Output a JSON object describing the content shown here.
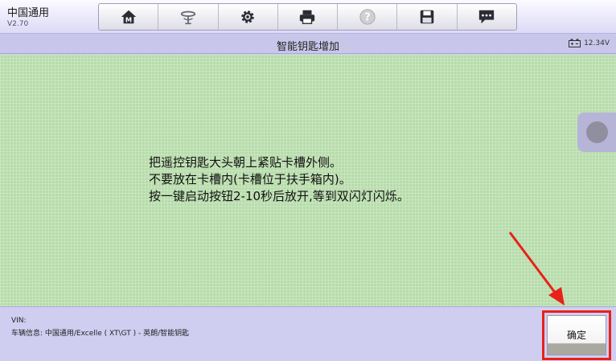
{
  "app": {
    "title": "中国通用",
    "version": "V2.70"
  },
  "toolbar": {
    "items": [
      {
        "name": "home-icon",
        "label": "M"
      },
      {
        "name": "vehicle-change-icon"
      },
      {
        "name": "settings-icon"
      },
      {
        "name": "print-icon"
      },
      {
        "name": "help-icon"
      },
      {
        "name": "save-icon"
      },
      {
        "name": "message-icon"
      }
    ]
  },
  "titlebar": {
    "title": "智能钥匙增加",
    "voltage": "12.34V"
  },
  "main": {
    "instructions": [
      "把遥控钥匙大头朝上紧贴卡槽外侧。",
      "不要放在卡槽内(卡槽位于扶手箱内)。",
      "按一键启动按钮2-10秒后放开,等到双闪灯闪烁。"
    ]
  },
  "footer": {
    "vin_label": "VIN:",
    "vehicle_info": "车辆信息: 中国通用/Excelle ( XT\\GT ) - 英朗/智能钥匙",
    "confirm_label": "确定"
  },
  "colors": {
    "accent_red": "#e8211b",
    "content_green": "#b7dcab",
    "chrome": "#c9c8ee"
  }
}
